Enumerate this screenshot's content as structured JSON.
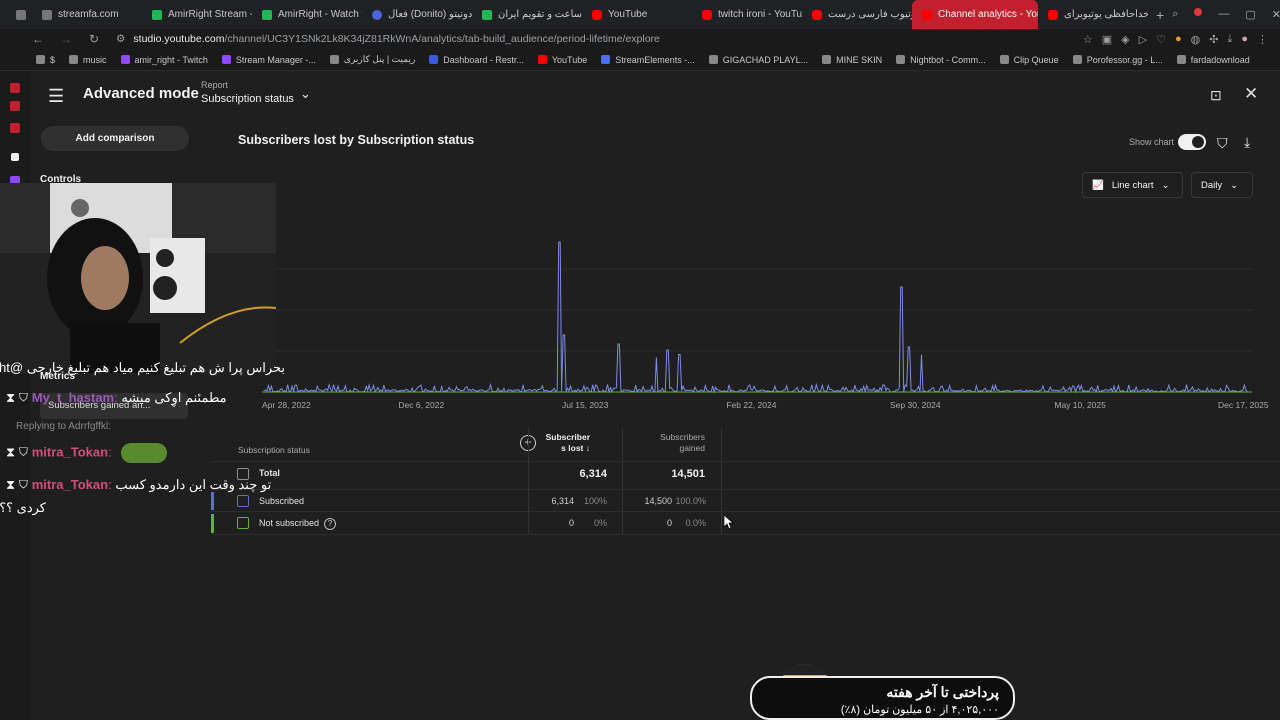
{
  "browser": {
    "tabs": [
      {
        "title": "streamfa.com",
        "icon": "gray"
      },
      {
        "title": "AmirRight Stream - ",
        "icon": "tw"
      },
      {
        "title": "AmirRight - Watch th",
        "icon": "tw"
      },
      {
        "title": "فعال (Donito) دونیتو",
        "icon": "blue"
      },
      {
        "title": "ساعت و تقویم ایران |",
        "icon": "tw"
      },
      {
        "title": "YouTube",
        "icon": "yt"
      },
      {
        "title": "twitch ironi - YouTub",
        "icon": "yt"
      },
      {
        "title": "آیا یوتیوب فارسی درست",
        "icon": "yt"
      },
      {
        "title": "Channel analytics - YouT",
        "icon": "yt",
        "active": true
      },
      {
        "title": "از خداحافظی یوتیوبرای",
        "icon": "yt"
      }
    ],
    "url_host": "studio.youtube.com",
    "url_path": "/channel/UC3Y1SNk2Lk8K34jZ81RkWnA/analytics/tab-build_audience/period-lifetime/explore",
    "bookmarks": [
      {
        "label": "$",
        "color": "#888"
      },
      {
        "label": "music",
        "color": "#888"
      },
      {
        "label": "amir_right - Twitch",
        "color": "#9146ff"
      },
      {
        "label": "Stream Manager -...",
        "color": "#9146ff"
      },
      {
        "label": "ریمیت | پنل کاربری",
        "color": "#888"
      },
      {
        "label": "Dashboard - Restr...",
        "color": "#3a5bd9"
      },
      {
        "label": "YouTube",
        "color": "#ff0000"
      },
      {
        "label": "StreamElements -...",
        "color": "#4a6cf7"
      },
      {
        "label": "GIGACHAD PLAYL...",
        "color": "#888"
      },
      {
        "label": "MINE SKIN",
        "color": "#888"
      },
      {
        "label": "Nightbot - Comm...",
        "color": "#888"
      },
      {
        "label": "Clip Queue",
        "color": "#888"
      },
      {
        "label": "Porofessor.gg - L...",
        "color": "#888"
      },
      {
        "label": "fardadownload",
        "color": "#888"
      }
    ]
  },
  "studio": {
    "mode_title": "Advanced mode",
    "report_label": "Report",
    "report_value": "Subscription status",
    "add_comparison": "Add comparison",
    "controls_label": "Controls",
    "chart_title": "Subscribers lost by Subscription status",
    "show_chart_label": "Show chart",
    "chart_type_label": "Line chart",
    "granularity_label": "Daily"
  },
  "chart_data": {
    "type": "line",
    "title": "Subscribers lost by Subscription status",
    "x_ticks": [
      "Apr 28, 2022",
      "Dec 6, 2022",
      "Jul 15, 2023",
      "Feb 22, 2024",
      "Sep 30, 2024",
      "May 10, 2025",
      "Dec 17, 2025"
    ],
    "x_range": [
      "Apr 28, 2022",
      "Dec 17, 2025"
    ],
    "gridlines": true,
    "series": [
      {
        "name": "Subscribed",
        "color": "#7a8ce8",
        "spikes": [
          {
            "date": "Jun 1, 2023",
            "value": 100
          },
          {
            "date": "Jun 7, 2023",
            "value": 38
          },
          {
            "date": "Aug 20, 2023",
            "value": 32
          },
          {
            "date": "Oct 10, 2023",
            "value": 23
          },
          {
            "date": "Oct 25, 2023",
            "value": 28
          },
          {
            "date": "Nov 10, 2023",
            "value": 25
          },
          {
            "date": "Sep 5, 2024",
            "value": 70
          },
          {
            "date": "Sep 15, 2024",
            "value": 30
          },
          {
            "date": "Oct 2, 2024",
            "value": 25
          }
        ],
        "baseline_value": 5
      },
      {
        "name": "Not subscribed",
        "color": "#5fb52f",
        "baseline_value": 0
      }
    ]
  },
  "table": {
    "col_status": "Subscription status",
    "col_lost_line1": "Subscriber",
    "col_lost_line2": "s lost",
    "col_gained_line1": "Subscribers",
    "col_gained_line2": "gained",
    "rows": [
      {
        "label": "Total",
        "lost": "6,314",
        "lost_pct": "",
        "gained": "14,501",
        "gained_pct": ""
      },
      {
        "label": "Subscribed",
        "lost": "6,314",
        "lost_pct": "100%",
        "gained": "14,500",
        "gained_pct": "100.0%"
      },
      {
        "label": "Not subscribed",
        "lost": "0",
        "lost_pct": "0%",
        "gained": "0",
        "gained_pct": "0.0%"
      }
    ]
  },
  "overlay": {
    "metrics_label": "Metrics",
    "subs_gained_label": "Subscribers gained an...",
    "chat": [
      {
        "user": "",
        "text": "بحراس پرا ش هم تبلیغ کنیم میاد هم تبلیغ خارجی @amirright",
        "color": "#ffffff"
      },
      {
        "user": "My_t_hastam",
        "text": "مطمئنم اوکی میشه",
        "color": "#9b59b6"
      },
      {
        "user": "",
        "text": "Replying to Adrrfgffkl:",
        "color": "#888888"
      },
      {
        "user": "mitra_Tokan",
        "text": "",
        "color": "#d64c7b"
      },
      {
        "user": "mitra_Tokan",
        "text": "تو چند وقت این دارمدو کسب",
        "color": "#d64c7b"
      },
      {
        "user": "",
        "text": "کردی ؟؟؟",
        "color": "#ffffff"
      }
    ],
    "banner_title": "پرداختی تا آخر هفته",
    "banner_sub": "۴,۰۲۵,۰۰۰ از ۵۰ میلیون تومان (۸٪)"
  }
}
